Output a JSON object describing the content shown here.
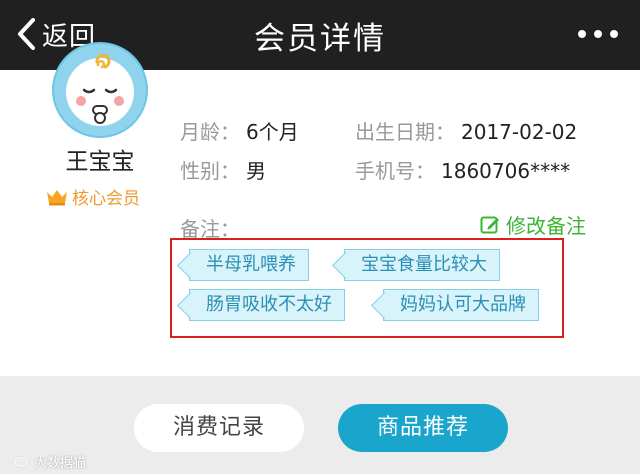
{
  "nav": {
    "back_label": "返回",
    "title": "会员详情"
  },
  "member": {
    "name": "王宝宝",
    "level": "核心会员",
    "age_label": "月龄：",
    "age_value": "6个月",
    "birth_label": "出生日期：",
    "birth_value": "2017-02-02",
    "gender_label": "性别：",
    "gender_value": "男",
    "phone_label": "手机号：",
    "phone_value": "1860706****"
  },
  "notes": {
    "label": "备注：",
    "edit_label": "修改备注",
    "tags": [
      "半母乳喂养",
      "宝宝食量比较大",
      "肠胃吸收不太好",
      "妈妈认可大品牌"
    ]
  },
  "actions": {
    "records_label": "消费记录",
    "products_label": "商品推荐"
  },
  "watermark": "大数据猫",
  "colors": {
    "navbar": "#202020",
    "accent_blue": "#1aa6cc",
    "tag_text": "#2a8fb4",
    "tag_bg": "#d9f3fb",
    "edit_green": "#3db534",
    "level_orange": "#f09a2d",
    "highlight_red": "#d92020"
  },
  "icons": [
    "back-chevron-icon",
    "more-dots-icon",
    "baby-avatar",
    "crown-icon",
    "edit-icon"
  ]
}
